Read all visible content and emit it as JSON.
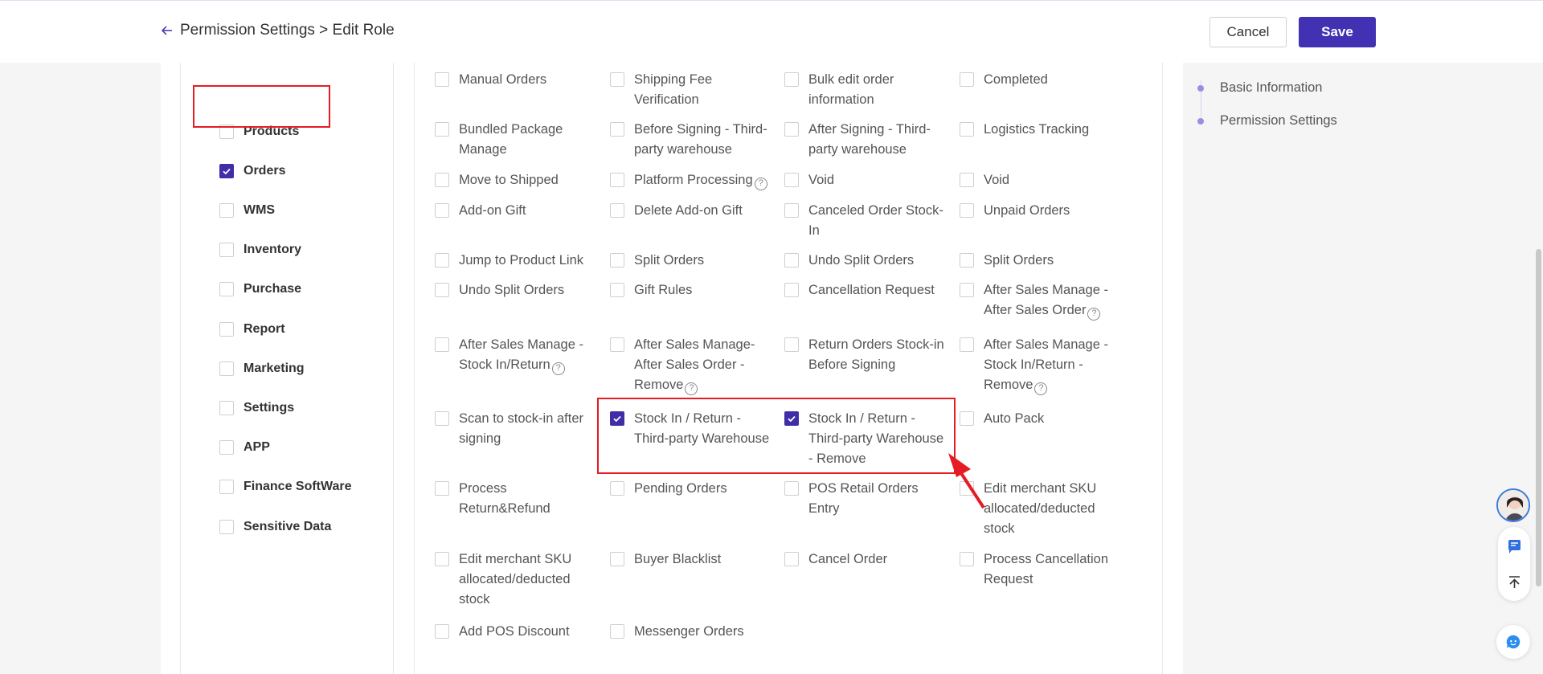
{
  "header": {
    "title": "Permission Settings > Edit Role",
    "cancel_label": "Cancel",
    "save_label": "Save"
  },
  "modules": [
    {
      "label": "Products",
      "checked": false
    },
    {
      "label": "Orders",
      "checked": true
    },
    {
      "label": "WMS",
      "checked": false
    },
    {
      "label": "Inventory",
      "checked": false
    },
    {
      "label": "Purchase",
      "checked": false
    },
    {
      "label": "Report",
      "checked": false
    },
    {
      "label": "Marketing",
      "checked": false
    },
    {
      "label": "Settings",
      "checked": false
    },
    {
      "label": "APP",
      "checked": false
    },
    {
      "label": "Finance SoftWare",
      "checked": false
    },
    {
      "label": "Sensitive Data",
      "checked": false
    }
  ],
  "permissions": [
    {
      "label": "Manual Orders",
      "checked": false,
      "help": false
    },
    {
      "label": "Shipping Fee Verification",
      "checked": false,
      "help": false
    },
    {
      "label": "Bulk edit order information",
      "checked": false,
      "help": false
    },
    {
      "label": "Completed",
      "checked": false,
      "help": false
    },
    {
      "label": "Bundled Package Manage",
      "checked": false,
      "help": false
    },
    {
      "label": "Before Signing - Third-party warehouse",
      "checked": false,
      "help": false
    },
    {
      "label": "After Signing - Third-party warehouse",
      "checked": false,
      "help": false
    },
    {
      "label": "Logistics Tracking",
      "checked": false,
      "help": false
    },
    {
      "label": "Move to Shipped",
      "checked": false,
      "help": false
    },
    {
      "label": "Platform Processing",
      "checked": false,
      "help": true
    },
    {
      "label": "Void",
      "checked": false,
      "help": false
    },
    {
      "label": "Void",
      "checked": false,
      "help": false
    },
    {
      "label": "Add-on Gift",
      "checked": false,
      "help": false
    },
    {
      "label": "Delete Add-on Gift",
      "checked": false,
      "help": false
    },
    {
      "label": "Canceled Order Stock-In",
      "checked": false,
      "help": false
    },
    {
      "label": "Unpaid Orders",
      "checked": false,
      "help": false
    },
    {
      "label": "Jump to Product Link",
      "checked": false,
      "help": false
    },
    {
      "label": "Split Orders",
      "checked": false,
      "help": false
    },
    {
      "label": "Undo Split Orders",
      "checked": false,
      "help": false
    },
    {
      "label": "Split Orders",
      "checked": false,
      "help": false
    },
    {
      "label": "Undo Split Orders",
      "checked": false,
      "help": false
    },
    {
      "label": "Gift Rules",
      "checked": false,
      "help": false
    },
    {
      "label": "Cancellation Request",
      "checked": false,
      "help": false
    },
    {
      "label": "After Sales Manage - After Sales Order",
      "checked": false,
      "help": true
    },
    {
      "label": "After Sales Manage - Stock In/Return",
      "checked": false,
      "help": true
    },
    {
      "label": "After Sales Manage-After Sales Order - Remove",
      "checked": false,
      "help": true
    },
    {
      "label": "Return Orders Stock-in Before Signing",
      "checked": false,
      "help": false
    },
    {
      "label": "After Sales Manage - Stock In/Return - Remove",
      "checked": false,
      "help": true
    },
    {
      "label": "Scan to stock-in after signing",
      "checked": false,
      "help": false
    },
    {
      "label": "Stock In / Return - Third-party Warehouse",
      "checked": true,
      "help": false
    },
    {
      "label": "Stock In / Return - Third-party Warehouse - Remove",
      "checked": true,
      "help": false
    },
    {
      "label": "Auto Pack",
      "checked": false,
      "help": false
    },
    {
      "label": "Process Return&Refund",
      "checked": false,
      "help": false
    },
    {
      "label": "Pending Orders",
      "checked": false,
      "help": false
    },
    {
      "label": "POS Retail Orders Entry",
      "checked": false,
      "help": false
    },
    {
      "label": "Edit merchant SKU allocated/deducted stock",
      "checked": false,
      "help": false
    },
    {
      "label": "Edit merchant SKU allocated/deducted stock",
      "checked": false,
      "help": false
    },
    {
      "label": "Buyer Blacklist",
      "checked": false,
      "help": false
    },
    {
      "label": "Cancel Order",
      "checked": false,
      "help": false
    },
    {
      "label": "Process Cancellation Request",
      "checked": false,
      "help": false
    },
    {
      "label": "Add POS Discount",
      "checked": false,
      "help": false
    },
    {
      "label": "Messenger Orders",
      "checked": false,
      "help": false
    }
  ],
  "anchors": [
    "Basic Information",
    "Permission Settings"
  ],
  "colors": {
    "accent": "#4331b3",
    "highlight": "#e51c23"
  },
  "icons": [
    "back-arrow-icon",
    "checkmark-icon",
    "help-icon",
    "support-agent-avatar",
    "message-icon",
    "back-to-top-icon",
    "chat-bot-icon"
  ]
}
